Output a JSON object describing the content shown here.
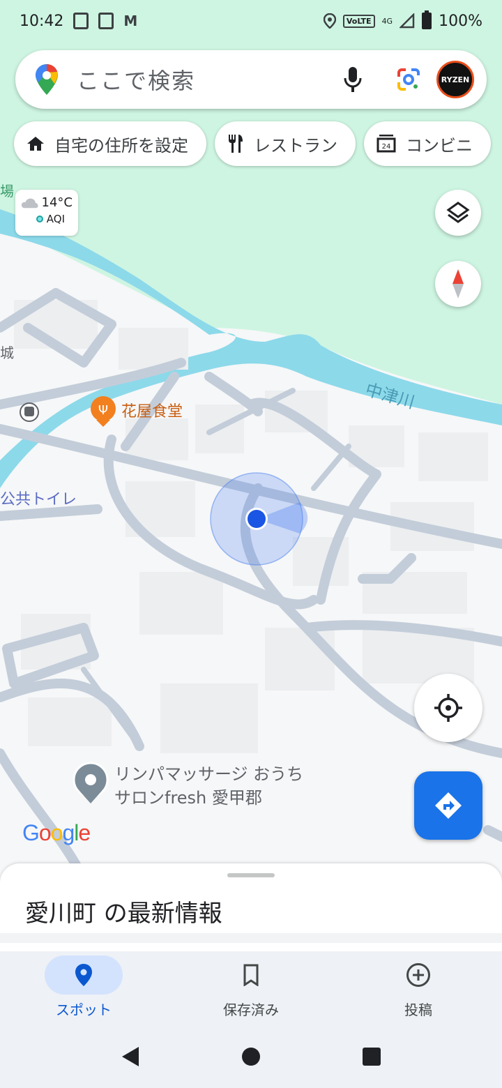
{
  "status_bar": {
    "time": "10:42",
    "network": "4G",
    "volte": "VoLTE",
    "battery": "100%"
  },
  "search": {
    "placeholder": "ここで検索",
    "avatar_text": "RYZEN"
  },
  "chips": [
    {
      "label": "自宅の住所を設定",
      "icon": "home-icon"
    },
    {
      "label": "レストラン",
      "icon": "restaurant-icon"
    },
    {
      "label": "コンビニ",
      "icon": "store-icon"
    }
  ],
  "weather": {
    "temp": "14°C",
    "aqi": "AQI"
  },
  "map_labels": {
    "river": "中津川",
    "restaurant": "花屋食堂",
    "toilet": "公共トイレ",
    "place1": "リンパマッサージ おうち",
    "place2": "サロンfresh 愛甲郡",
    "edge1": "場",
    "edge2": "城"
  },
  "google_logo": {
    "G": "G",
    "o1": "o",
    "o2": "o",
    "g": "g",
    "l": "l",
    "e": "e"
  },
  "sheet": {
    "title": "愛川町 の最新情報"
  },
  "nav": [
    {
      "label": "スポット",
      "icon": "location-pin-icon",
      "active": true
    },
    {
      "label": "保存済み",
      "icon": "bookmark-icon",
      "active": false
    },
    {
      "label": "投稿",
      "icon": "add-circle-icon",
      "active": false
    }
  ],
  "colors": {
    "accent": "#1a73e8",
    "park": "#cef5e2",
    "water": "#8cd9ea",
    "road": "#c3cdd9"
  }
}
